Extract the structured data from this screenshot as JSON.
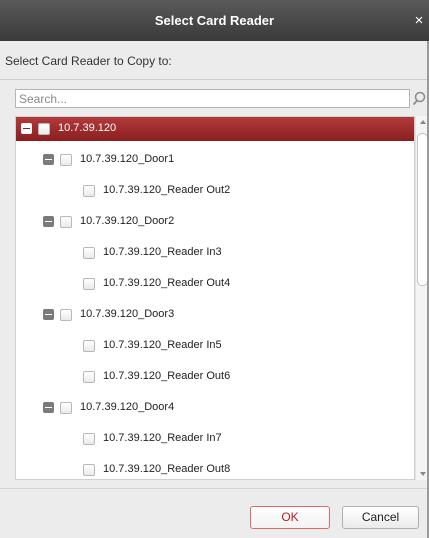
{
  "dialog": {
    "title": "Select Card Reader",
    "close_glyph": "×",
    "section_label": "Select Card Reader to Copy to:"
  },
  "search": {
    "placeholder": "Search...",
    "icon": "search-icon"
  },
  "tree": {
    "selected_color": "#9a2a2a",
    "rows": [
      {
        "label": "10.7.39.120",
        "level": 0,
        "expandable": true,
        "selected": true
      },
      {
        "label": "10.7.39.120_Door1",
        "level": 1,
        "expandable": true,
        "selected": false
      },
      {
        "label": "10.7.39.120_Reader Out2",
        "level": 2,
        "expandable": false,
        "selected": false
      },
      {
        "label": "10.7.39.120_Door2",
        "level": 1,
        "expandable": true,
        "selected": false
      },
      {
        "label": "10.7.39.120_Reader In3",
        "level": 2,
        "expandable": false,
        "selected": false
      },
      {
        "label": "10.7.39.120_Reader Out4",
        "level": 2,
        "expandable": false,
        "selected": false
      },
      {
        "label": "10.7.39.120_Door3",
        "level": 1,
        "expandable": true,
        "selected": false
      },
      {
        "label": "10.7.39.120_Reader In5",
        "level": 2,
        "expandable": false,
        "selected": false
      },
      {
        "label": "10.7.39.120_Reader Out6",
        "level": 2,
        "expandable": false,
        "selected": false
      },
      {
        "label": "10.7.39.120_Door4",
        "level": 1,
        "expandable": true,
        "selected": false
      },
      {
        "label": "10.7.39.120_Reader In7",
        "level": 2,
        "expandable": false,
        "selected": false
      },
      {
        "label": "10.7.39.120_Reader Out8",
        "level": 2,
        "expandable": false,
        "selected": false
      }
    ]
  },
  "buttons": {
    "ok": "OK",
    "cancel": "Cancel"
  }
}
